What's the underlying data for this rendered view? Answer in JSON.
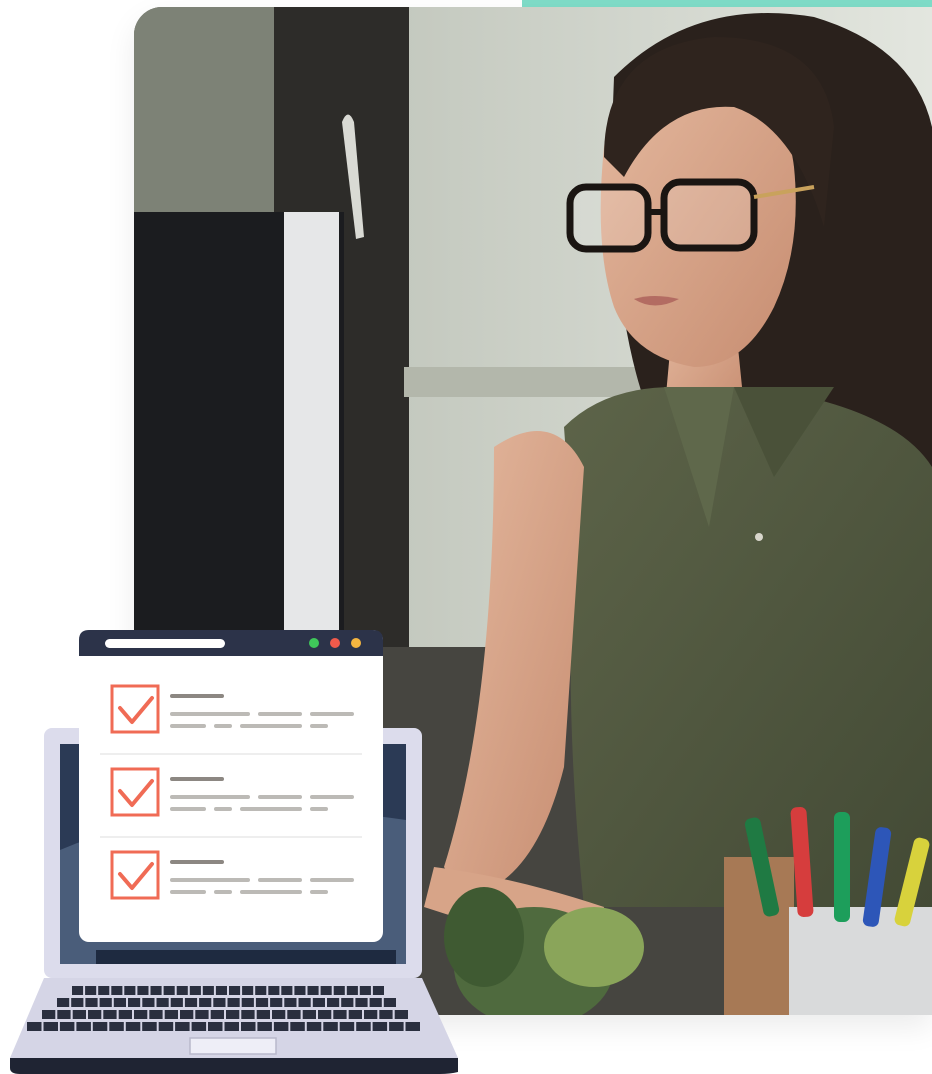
{
  "scene": {
    "accent_color": "#7fdcc8",
    "illustration": {
      "checklist_items": [
        {
          "checked": true
        },
        {
          "checked": true
        },
        {
          "checked": true
        }
      ],
      "window_dots": [
        "#3fc85a",
        "#f05a4b",
        "#f5b640"
      ],
      "check_color": "#f06b55"
    }
  }
}
